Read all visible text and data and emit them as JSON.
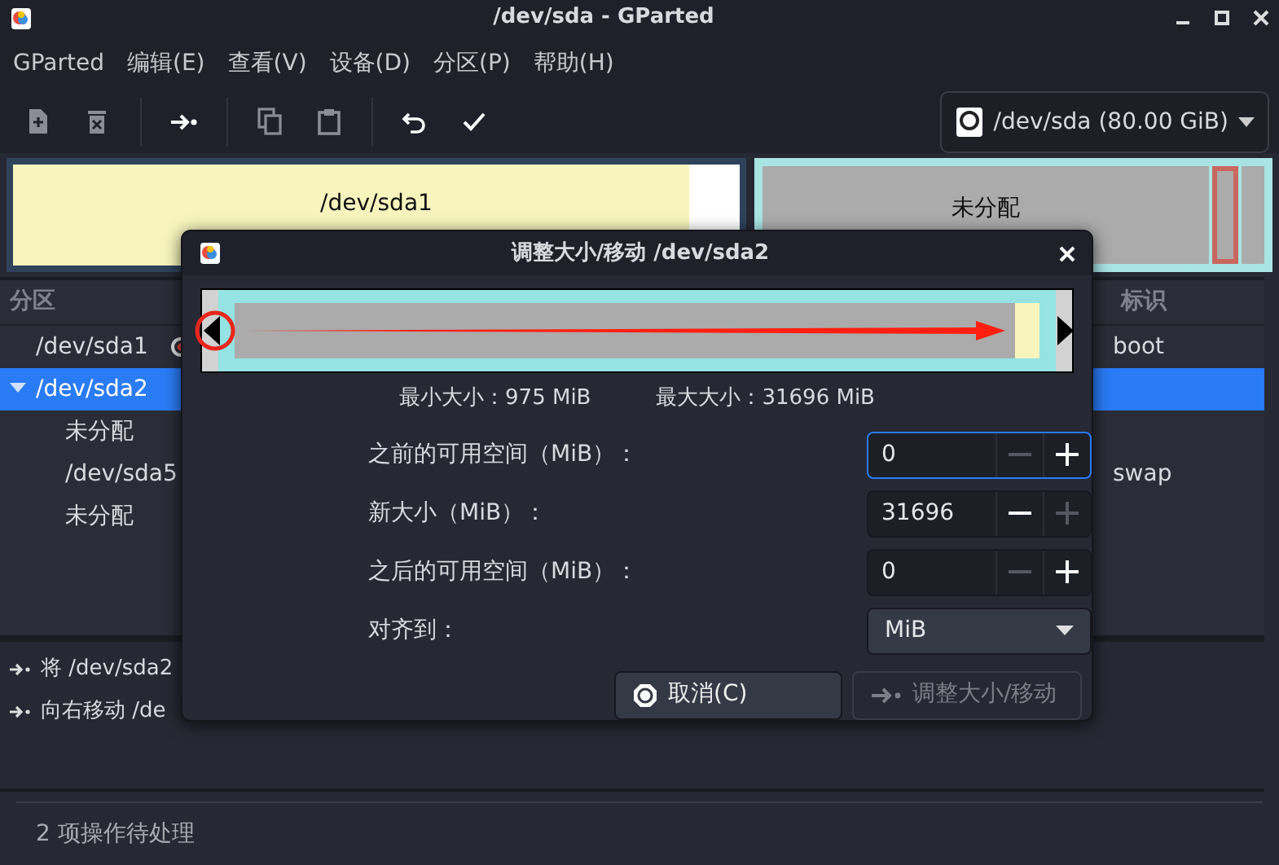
{
  "window": {
    "title": "/dev/sda - GParted"
  },
  "menu": [
    "GParted",
    "编辑(E)",
    "查看(V)",
    "设备(D)",
    "分区(P)",
    "帮助(H)"
  ],
  "toolbar": [
    {
      "kind": "new",
      "disabled": true
    },
    {
      "kind": "delete",
      "disabled": true
    },
    {
      "kind": "resize",
      "disabled": false
    },
    {
      "kind": "copy",
      "disabled": true
    },
    {
      "kind": "paste",
      "disabled": true
    },
    {
      "kind": "undo",
      "disabled": false
    },
    {
      "kind": "apply",
      "disabled": false
    }
  ],
  "device_selector": {
    "label": "/dev/sda (80.00 GiB)"
  },
  "disk_map": [
    {
      "kind": "primary",
      "name": "/dev/sda1",
      "level": 0.93
    },
    {
      "kind": "extended",
      "name": "未分配"
    }
  ],
  "partitions": {
    "columns": [
      "分区",
      "标识"
    ],
    "rows": [
      {
        "name": "/dev/sda1",
        "mounted": true,
        "flags": "boot",
        "selected": false
      },
      {
        "name": "/dev/sda2",
        "mounted": false,
        "expanded": true,
        "selected": true,
        "children": [
          {
            "name": "未分配",
            "mounted": false,
            "selected": false
          },
          {
            "name": "/dev/sda5",
            "mounted": false,
            "flags": "swap",
            "selected": false
          },
          {
            "name": "未分配",
            "mounted": false,
            "selected": false
          }
        ]
      }
    ]
  },
  "operations": [
    "将 /dev/sda2",
    "向右移动 /de"
  ],
  "status_bar": "2 项操作待处理",
  "dialog": {
    "title": "调整大小/移动 /dev/sda2",
    "min_size": "最小大小：975 MiB",
    "max_size": "最大大小：31696 MiB",
    "fields": [
      {
        "label": "之前的可用空间（MiB）：",
        "value": "0",
        "focused": true,
        "minus_disabled": true,
        "plus_disabled": false
      },
      {
        "label": "新大小（MiB）：",
        "value": "31696",
        "focused": false,
        "minus_disabled": false,
        "plus_disabled": true
      },
      {
        "label": "之后的可用空间（MiB）：",
        "value": "0",
        "focused": false,
        "minus_disabled": true,
        "plus_disabled": false
      }
    ],
    "align": {
      "label": "对齐到：",
      "value": "MiB"
    },
    "buttons": [
      {
        "label": "取消(C)",
        "kind": "cancel",
        "disabled": false
      },
      {
        "label": "调整大小/移动",
        "kind": "resize",
        "disabled": true
      }
    ]
  }
}
